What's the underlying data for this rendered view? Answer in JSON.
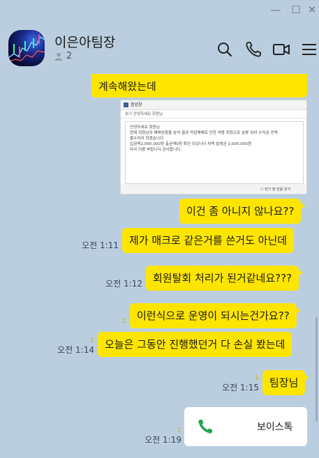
{
  "window": {
    "minimize": "—",
    "maximize": "☐",
    "close": "✕"
  },
  "header": {
    "title": "이은아팀장",
    "member_count": "2"
  },
  "messages": [
    {
      "text": "계속해왔는데"
    },
    {
      "image": {
        "window_title": "팝업창",
        "tabs": "보기    안녕하세요 회원님",
        "lines": [
          "안녕하세요 회원님",
          "현재 회원님의 매매성향을 분석 결과 작업매매로 인한 악용 회원으로 분류 되어 수익금 전액",
          "몰수처리 하겠습니다",
          "입금액2,000,000원 출금액0원 확인 되었니다 차액 발생금 2,000,000원",
          "타사 이용 바랍니다 감사합니다."
        ],
        "check1": "☐ 닫기 창 닫음",
        "check2": "닫기"
      }
    },
    {
      "text": "이건 좀 아니지 않나요??"
    },
    {
      "text": "제가 매크로 같은거를 쓴거도 아닌데",
      "time": "오전 1:11"
    },
    {
      "text": "회원탈회 처리가 된거같네요???",
      "time": "오전 1:12"
    },
    {
      "text": "이런식으로 운영이 되시는건가요??",
      "unread": "1"
    },
    {
      "text": "오늘은 그동안 진행했던거 다 손실 봤는데",
      "unread": "1",
      "time": "오전 1:14"
    },
    {
      "text": "팀장님",
      "unread": "1",
      "time": "오전 1:15"
    },
    {
      "voice_label": "보이스톡",
      "unread": "1",
      "time": "오전 1:19"
    }
  ]
}
